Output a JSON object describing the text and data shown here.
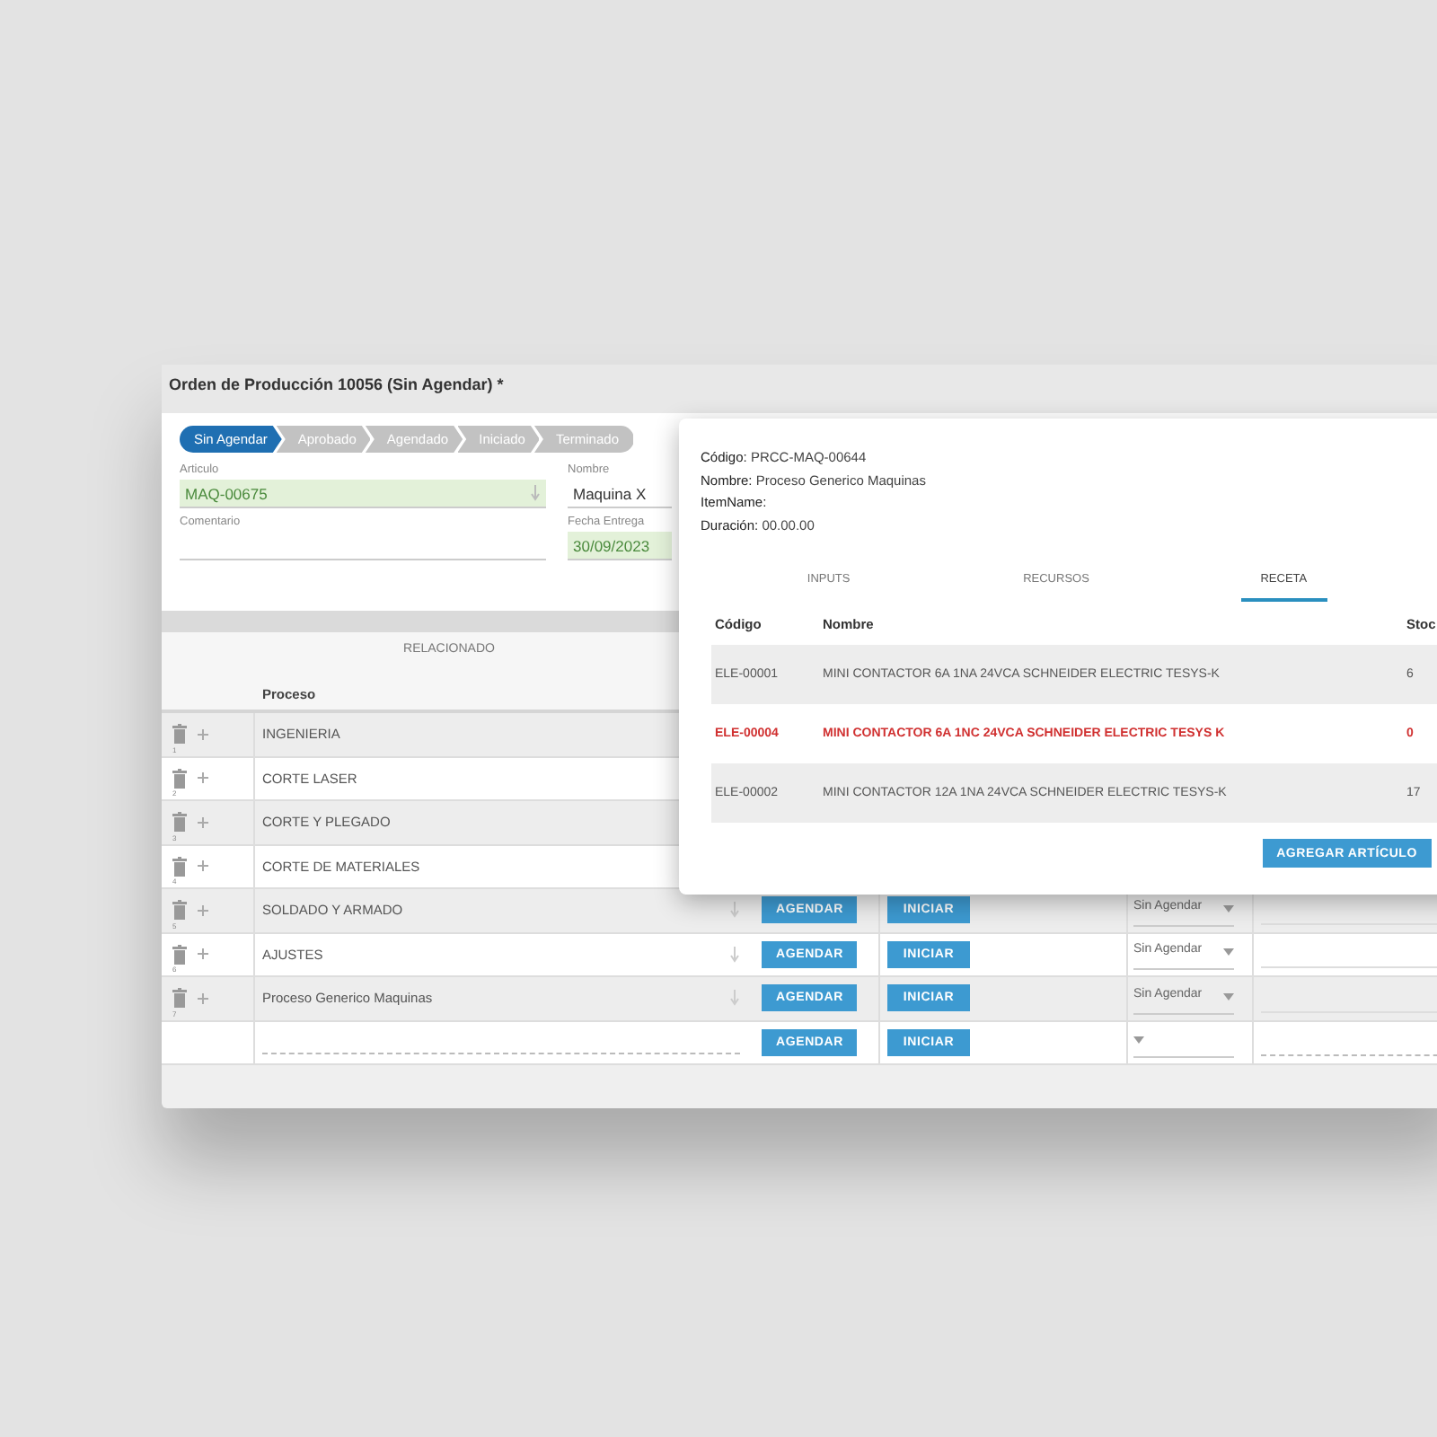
{
  "window": {
    "title": "Orden de Producción 10056 (Sin Agendar) *"
  },
  "steps": [
    {
      "label": "Sin Agendar",
      "selected": true
    },
    {
      "label": "Aprobado",
      "selected": false
    },
    {
      "label": "Agendado",
      "selected": false
    },
    {
      "label": "Iniciado",
      "selected": false
    },
    {
      "label": "Terminado",
      "selected": false
    }
  ],
  "fields": [
    {
      "label": "Articulo",
      "value": "MAQ-00675",
      "highlighted": true,
      "lookup": true
    },
    {
      "label": "Nombre",
      "value": "Maquina X",
      "highlighted": false,
      "lookup": false
    },
    {
      "label": "Comentario",
      "highlighted": false,
      "lookup": false
    },
    {
      "label": "Fecha Entrega",
      "value": "30/09/2023",
      "highlighted": true,
      "lookup": false
    }
  ],
  "section": {
    "title": "RELACIONADO"
  },
  "table": {
    "columns": [
      "Proceso"
    ],
    "rows": [
      {
        "number": "1",
        "proceso": "INGENIERIA"
      },
      {
        "number": "2",
        "proceso": "CORTE LASER"
      },
      {
        "number": "3",
        "proceso": "CORTE Y PLEGADO"
      },
      {
        "number": "4",
        "proceso": "CORTE DE MATERIALES"
      },
      {
        "number": "5",
        "proceso": "SOLDADO Y ARMADO",
        "actions": [
          "AGENDAR",
          "INICIAR"
        ],
        "estado": "Sin Agendar"
      },
      {
        "number": "6",
        "proceso": "AJUSTES",
        "actions": [
          "AGENDAR",
          "INICIAR"
        ],
        "estado": "Sin Agendar"
      },
      {
        "number": "7",
        "proceso": "Proceso Generico Maquinas",
        "actions": [
          "AGENDAR",
          "INICIAR"
        ],
        "estado": "Sin Agendar"
      },
      {
        "kind": "new",
        "actions": [
          "AGENDAR",
          "INICIAR"
        ]
      }
    ]
  },
  "dialog": {
    "info": [
      "**Código:** PRCC-MAQ-00644",
      "**Nombre:** Proceso Generico Maquinas",
      "**ItemName:**",
      "**Duración:** 00.00.00"
    ],
    "tabs": [
      {
        "label": "INPUTS",
        "selected": false
      },
      {
        "label": "RECURSOS",
        "selected": false
      },
      {
        "label": "RECETA",
        "selected": true
      }
    ],
    "columns": [
      "Código",
      "Nombre",
      "Stoc"
    ],
    "rows": [
      {
        "codigo": "ELE-00001",
        "nombre": "MINI CONTACTOR 6A 1NA 24VCA SCHNEIDER ELECTRIC TESYS-K",
        "stock": "6",
        "alert": false
      },
      {
        "codigo": "ELE-00004",
        "nombre": "MINI CONTACTOR 6A 1NC 24VCA SCHNEIDER ELECTRIC TESYS K",
        "stock": "0",
        "alert": true
      },
      {
        "codigo": "ELE-00002",
        "nombre": "MINI CONTACTOR 12A 1NA 24VCA SCHNEIDER ELECTRIC TESYS-K",
        "stock": "17",
        "alert": false
      }
    ],
    "button": "AGREGAR ARTÍCULO"
  }
}
